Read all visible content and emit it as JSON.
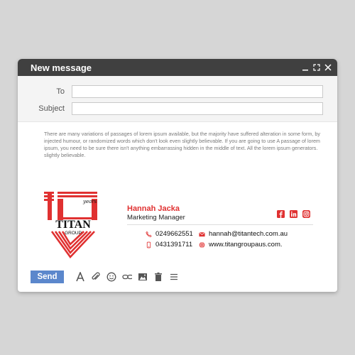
{
  "window": {
    "title": "New message"
  },
  "fields": {
    "to_label": "To",
    "to_value": "",
    "subject_label": "Subject",
    "subject_value": ""
  },
  "body_text": "There are many variations of passages of lorem ipsum available, but the majority have suffered alteration in some form, by injected humour, or randomized words which don't look even slightly believable. If you are going to use A passage of lorem ipsum, you need to be sure there isn't anything embarrassing hidden in the middle of text. All the lorem ipsum generators. slightly believable.",
  "signature": {
    "logo_wordmark": "TITAN",
    "logo_sub": "GROUP",
    "logo_years": "years",
    "name": "Hannah Jacka",
    "role": "Marketing Manager",
    "phone1": "0249662551",
    "phone2": "0431391711",
    "email": "hannah@titantech.com.au",
    "website": "www.titangroupaus.com.",
    "social": [
      "facebook-icon",
      "linkedin-icon",
      "instagram-icon"
    ]
  },
  "toolbar": {
    "send_label": "Send",
    "tools": [
      "format-text-icon",
      "attach-icon",
      "emoji-icon",
      "link-icon",
      "image-icon",
      "trash-icon",
      "more-options-icon"
    ]
  },
  "colors": {
    "accent": "#e03131",
    "send": "#5b87cc",
    "titlebar": "#404040"
  }
}
